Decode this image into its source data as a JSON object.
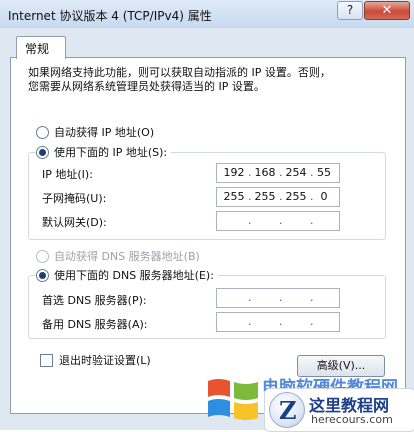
{
  "window": {
    "title": "Internet 协议版本 4 (TCP/IPv4) 属性",
    "help_glyph": "?",
    "close_glyph": "✕"
  },
  "tab": {
    "label": "常规"
  },
  "description": "如果网络支持此功能，则可以获取自动指派的 IP 设置。否则，\n您需要从网络系统管理员处获得适当的 IP 设置。",
  "ip_section": {
    "auto_label": "自动获得 IP 地址(O)",
    "manual_label": "使用下面的 IP 地址(S):",
    "selected": "manual",
    "fields": [
      {
        "label": "IP 地址(I):",
        "octets": [
          "192",
          "168",
          "254",
          "55"
        ]
      },
      {
        "label": "子网掩码(U):",
        "octets": [
          "255",
          "255",
          "255",
          "0"
        ]
      },
      {
        "label": "默认网关(D):",
        "octets": [
          "",
          "",
          "",
          ""
        ]
      }
    ]
  },
  "dns_section": {
    "auto_label": "自动获得 DNS 服务器地址(B)",
    "manual_label": "使用下面的 DNS 服务器地址(E):",
    "selected": "manual",
    "fields": [
      {
        "label": "首选 DNS 服务器(P):",
        "octets": [
          "",
          "",
          "",
          ""
        ]
      },
      {
        "label": "备用 DNS 服务器(A):",
        "octets": [
          "",
          "",
          "",
          ""
        ]
      }
    ]
  },
  "validate_label": "退出时验证设置(L)",
  "advanced_label": "高级(V)...",
  "watermark": {
    "text": "电脑软硬件教程网",
    "badge_letter": "Z",
    "badge_name": "这里教程网",
    "badge_url": "herecours.com"
  }
}
